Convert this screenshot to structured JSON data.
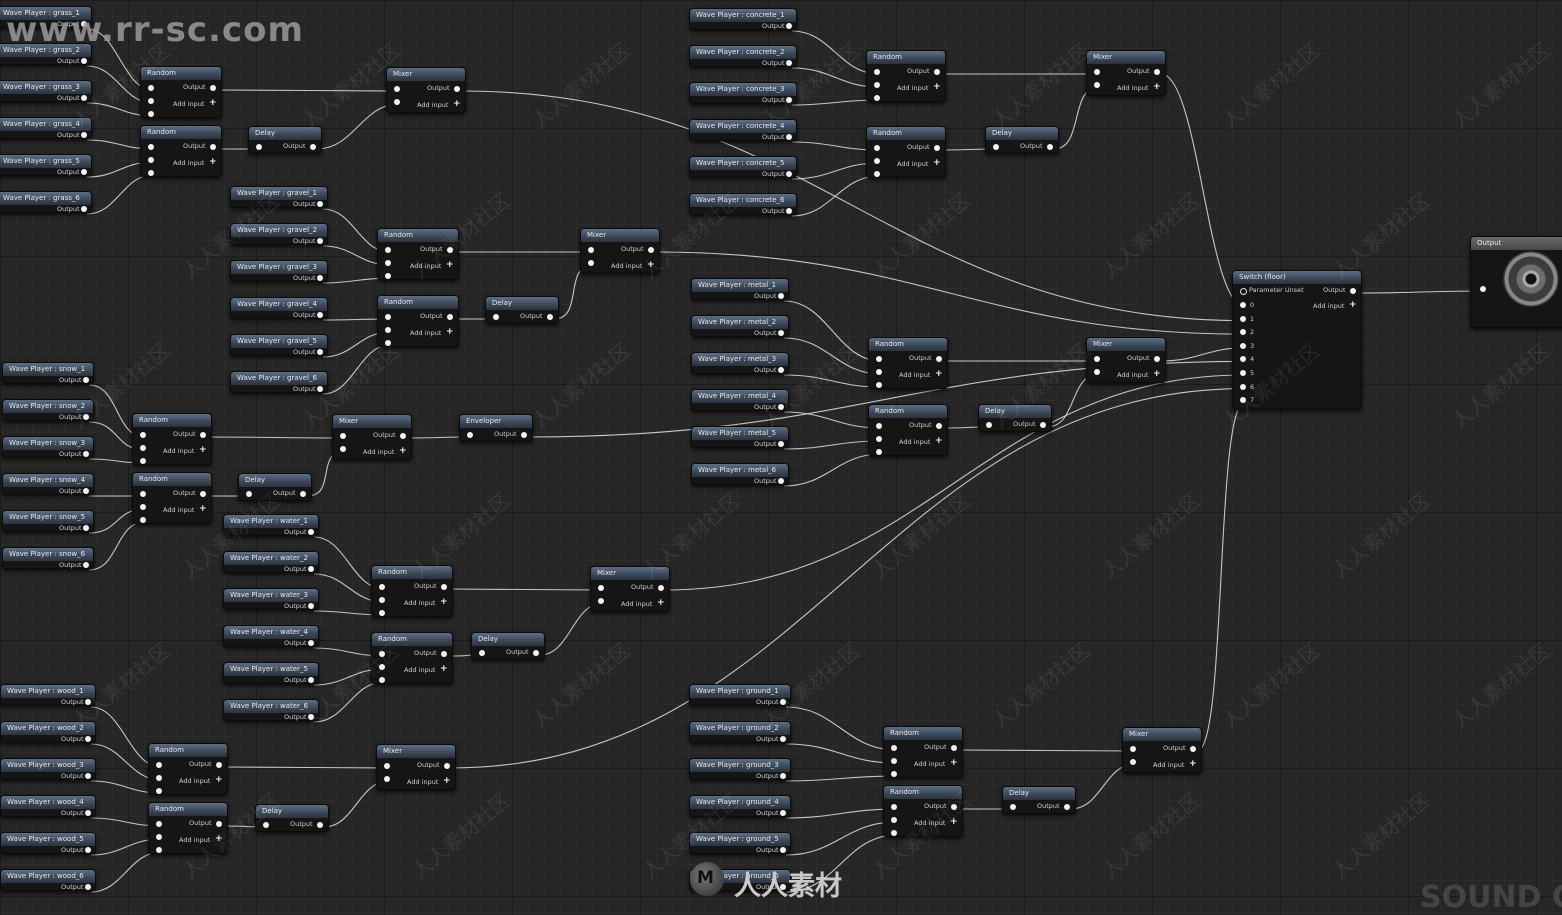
{
  "watermark": {
    "url": "www.rr-sc.com",
    "text": "人人素材社区",
    "brand": "人人素材",
    "corner": "SOUND C"
  },
  "labels": {
    "output": "Output",
    "add_input": "Add input",
    "parameter_unset": "Parameter Unset"
  },
  "nodes": [
    {
      "id": "g1",
      "title": "Wave Player : grass_1"
    },
    {
      "id": "g2",
      "title": "Wave Player : grass_2"
    },
    {
      "id": "g3",
      "title": "Wave Player : grass_3"
    },
    {
      "id": "g4",
      "title": "Wave Player : grass_4"
    },
    {
      "id": "g5",
      "title": "Wave Player : grass_5"
    },
    {
      "id": "g6",
      "title": "Wave Player : grass_6"
    },
    {
      "id": "gr_r1",
      "title": "Random"
    },
    {
      "id": "gr_r2",
      "title": "Random"
    },
    {
      "id": "gr_d",
      "title": "Delay"
    },
    {
      "id": "gr_m",
      "title": "Mixer"
    },
    {
      "id": "v1",
      "title": "Wave Player : gravel_1"
    },
    {
      "id": "v2",
      "title": "Wave Player : gravel_2"
    },
    {
      "id": "v3",
      "title": "Wave Player : gravel_3"
    },
    {
      "id": "v4",
      "title": "Wave Player : gravel_4"
    },
    {
      "id": "v5",
      "title": "Wave Player : gravel_5"
    },
    {
      "id": "v6",
      "title": "Wave Player : gravel_6"
    },
    {
      "id": "v_r1",
      "title": "Random"
    },
    {
      "id": "v_r2",
      "title": "Random"
    },
    {
      "id": "v_d",
      "title": "Delay"
    },
    {
      "id": "v_m",
      "title": "Mixer"
    },
    {
      "id": "s1",
      "title": "Wave Player : snow_1"
    },
    {
      "id": "s2",
      "title": "Wave Player : snow_2"
    },
    {
      "id": "s3",
      "title": "Wave Player : snow_3"
    },
    {
      "id": "s4",
      "title": "Wave Player : snow_4"
    },
    {
      "id": "s5",
      "title": "Wave Player : snow_5"
    },
    {
      "id": "s6",
      "title": "Wave Player : snow_6"
    },
    {
      "id": "s_r1",
      "title": "Random"
    },
    {
      "id": "s_r2",
      "title": "Random"
    },
    {
      "id": "s_d",
      "title": "Delay"
    },
    {
      "id": "s_m",
      "title": "Mixer"
    },
    {
      "id": "s_env",
      "title": "Enveloper"
    },
    {
      "id": "w1",
      "title": "Wave Player : water_1"
    },
    {
      "id": "w2",
      "title": "Wave Player : water_2"
    },
    {
      "id": "w3",
      "title": "Wave Player : water_3"
    },
    {
      "id": "w4",
      "title": "Wave Player : water_4"
    },
    {
      "id": "w5",
      "title": "Wave Player : water_5"
    },
    {
      "id": "w6",
      "title": "Wave Player : water_6"
    },
    {
      "id": "w_r1",
      "title": "Random"
    },
    {
      "id": "w_r2",
      "title": "Random"
    },
    {
      "id": "w_d",
      "title": "Delay"
    },
    {
      "id": "w_m",
      "title": "Mixer"
    },
    {
      "id": "o1",
      "title": "Wave Player : wood_1"
    },
    {
      "id": "o2",
      "title": "Wave Player : wood_2"
    },
    {
      "id": "o3",
      "title": "Wave Player : wood_3"
    },
    {
      "id": "o4",
      "title": "Wave Player : wood_4"
    },
    {
      "id": "o5",
      "title": "Wave Player : wood_5"
    },
    {
      "id": "o6",
      "title": "Wave Player : wood_6"
    },
    {
      "id": "o_r1",
      "title": "Random"
    },
    {
      "id": "o_r2",
      "title": "Random"
    },
    {
      "id": "o_d",
      "title": "Delay"
    },
    {
      "id": "o_m",
      "title": "Mixer"
    },
    {
      "id": "c1",
      "title": "Wave Player : concrete_1"
    },
    {
      "id": "c2",
      "title": "Wave Player : concrete_2"
    },
    {
      "id": "c3",
      "title": "Wave Player : concrete_3"
    },
    {
      "id": "c4",
      "title": "Wave Player : concrete_4"
    },
    {
      "id": "c5",
      "title": "Wave Player : concrete_5"
    },
    {
      "id": "c6",
      "title": "Wave Player : concrete_6"
    },
    {
      "id": "c_r1",
      "title": "Random"
    },
    {
      "id": "c_r2",
      "title": "Random"
    },
    {
      "id": "c_d",
      "title": "Delay"
    },
    {
      "id": "c_m",
      "title": "Mixer"
    },
    {
      "id": "m1",
      "title": "Wave Player : metal_1"
    },
    {
      "id": "m2",
      "title": "Wave Player : metal_2"
    },
    {
      "id": "m3",
      "title": "Wave Player : metal_3"
    },
    {
      "id": "m4",
      "title": "Wave Player : metal_4"
    },
    {
      "id": "m5",
      "title": "Wave Player : metal_5"
    },
    {
      "id": "m6",
      "title": "Wave Player : metal_6"
    },
    {
      "id": "m_r1",
      "title": "Random"
    },
    {
      "id": "m_r2",
      "title": "Random"
    },
    {
      "id": "m_d",
      "title": "Delay"
    },
    {
      "id": "m_m",
      "title": "Mixer"
    },
    {
      "id": "d1",
      "title": "Wave Player : ground_1"
    },
    {
      "id": "d2",
      "title": "Wave Player : ground_2"
    },
    {
      "id": "d3",
      "title": "Wave Player : ground_3"
    },
    {
      "id": "d4",
      "title": "Wave Player : ground_4"
    },
    {
      "id": "d5",
      "title": "Wave Player : ground_5"
    },
    {
      "id": "d6",
      "title": "Wave Player : ground_6"
    },
    {
      "id": "d_r1",
      "title": "Random"
    },
    {
      "id": "d_r2",
      "title": "Random"
    },
    {
      "id": "d_d",
      "title": "Delay"
    },
    {
      "id": "d_m",
      "title": "Mixer"
    },
    {
      "id": "sw",
      "title": "Switch (floor)",
      "inputs": [
        "0",
        "1",
        "2",
        "3",
        "4",
        "5",
        "6",
        "7"
      ]
    },
    {
      "id": "out",
      "title": "Output"
    }
  ],
  "wires": [
    [
      "g1",
      "gr_r1",
      0
    ],
    [
      "g2",
      "gr_r1",
      1
    ],
    [
      "g3",
      "gr_r1",
      2
    ],
    [
      "g4",
      "gr_r2",
      0
    ],
    [
      "g5",
      "gr_r2",
      1
    ],
    [
      "g6",
      "gr_r2",
      2
    ],
    [
      "gr_r1",
      "gr_m",
      0
    ],
    [
      "gr_r2",
      "gr_d",
      0
    ],
    [
      "gr_d",
      "gr_m",
      1
    ],
    [
      "gr_m",
      "sw",
      1
    ],
    [
      "v1",
      "v_r1",
      0
    ],
    [
      "v2",
      "v_r1",
      1
    ],
    [
      "v3",
      "v_r1",
      2
    ],
    [
      "v4",
      "v_r2",
      0
    ],
    [
      "v5",
      "v_r2",
      1
    ],
    [
      "v6",
      "v_r2",
      2
    ],
    [
      "v_r1",
      "v_m",
      0
    ],
    [
      "v_r2",
      "v_d",
      0
    ],
    [
      "v_d",
      "v_m",
      1
    ],
    [
      "v_m",
      "sw",
      2
    ],
    [
      "s1",
      "s_r1",
      0
    ],
    [
      "s2",
      "s_r1",
      1
    ],
    [
      "s3",
      "s_r1",
      2
    ],
    [
      "s4",
      "s_r2",
      0
    ],
    [
      "s5",
      "s_r2",
      1
    ],
    [
      "s6",
      "s_r2",
      2
    ],
    [
      "s_r1",
      "s_m",
      0
    ],
    [
      "s_r2",
      "s_d",
      0
    ],
    [
      "s_d",
      "s_m",
      1
    ],
    [
      "s_m",
      "s_env",
      0
    ],
    [
      "s_env",
      "sw",
      4
    ],
    [
      "w1",
      "w_r1",
      0
    ],
    [
      "w2",
      "w_r1",
      1
    ],
    [
      "w3",
      "w_r1",
      2
    ],
    [
      "w4",
      "w_r2",
      0
    ],
    [
      "w5",
      "w_r2",
      1
    ],
    [
      "w6",
      "w_r2",
      2
    ],
    [
      "w_r1",
      "w_m",
      0
    ],
    [
      "w_r2",
      "w_d",
      0
    ],
    [
      "w_d",
      "w_m",
      1
    ],
    [
      "w_m",
      "sw",
      5
    ],
    [
      "o1",
      "o_r1",
      0
    ],
    [
      "o2",
      "o_r1",
      1
    ],
    [
      "o3",
      "o_r1",
      2
    ],
    [
      "o4",
      "o_r2",
      0
    ],
    [
      "o5",
      "o_r2",
      1
    ],
    [
      "o6",
      "o_r2",
      2
    ],
    [
      "o_r1",
      "o_m",
      0
    ],
    [
      "o_r2",
      "o_d",
      0
    ],
    [
      "o_d",
      "o_m",
      1
    ],
    [
      "o_m",
      "sw",
      6
    ],
    [
      "c1",
      "c_r1",
      0
    ],
    [
      "c2",
      "c_r1",
      1
    ],
    [
      "c3",
      "c_r1",
      2
    ],
    [
      "c4",
      "c_r2",
      0
    ],
    [
      "c5",
      "c_r2",
      1
    ],
    [
      "c6",
      "c_r2",
      2
    ],
    [
      "c_r1",
      "c_m",
      0
    ],
    [
      "c_r2",
      "c_d",
      0
    ],
    [
      "c_d",
      "c_m",
      1
    ],
    [
      "c_m",
      "sw",
      0
    ],
    [
      "m1",
      "m_r1",
      0
    ],
    [
      "m2",
      "m_r1",
      1
    ],
    [
      "m3",
      "m_r1",
      2
    ],
    [
      "m4",
      "m_r2",
      0
    ],
    [
      "m5",
      "m_r2",
      1
    ],
    [
      "m6",
      "m_r2",
      2
    ],
    [
      "m_r1",
      "m_m",
      0
    ],
    [
      "m_r2",
      "m_d",
      0
    ],
    [
      "m_d",
      "m_m",
      1
    ],
    [
      "m_m",
      "sw",
      3
    ],
    [
      "d1",
      "d_r1",
      0
    ],
    [
      "d2",
      "d_r1",
      1
    ],
    [
      "d3",
      "d_r1",
      2
    ],
    [
      "d4",
      "d_r2",
      0
    ],
    [
      "d5",
      "d_r2",
      1
    ],
    [
      "d6",
      "d_r2",
      2
    ],
    [
      "d_r1",
      "d_m",
      0
    ],
    [
      "d_r2",
      "d_d",
      0
    ],
    [
      "d_d",
      "d_m",
      1
    ],
    [
      "d_m",
      "sw",
      7
    ],
    [
      "sw",
      "out",
      0
    ]
  ]
}
